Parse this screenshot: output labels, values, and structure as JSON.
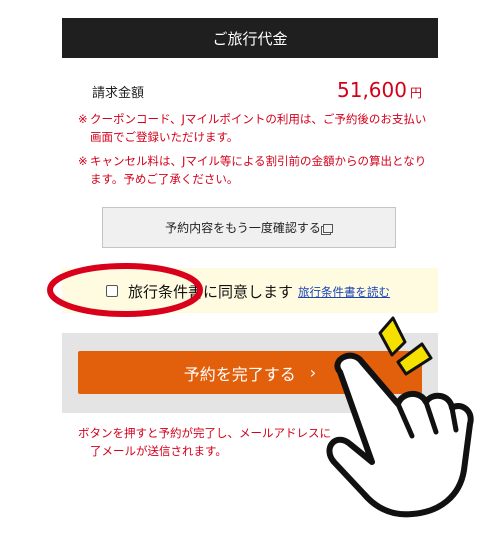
{
  "header": {
    "title": "ご旅行代金"
  },
  "amount": {
    "label": "請求金額",
    "value": "51,600",
    "unit": "円"
  },
  "notes": [
    {
      "mark": "※",
      "text": "クーポンコード、Jマイルポイントの利用は、ご予約後のお支払い画面でご登録いただけます。"
    },
    {
      "mark": "※",
      "text": "キャンセル料は、Jマイル等による割引前の金額からの算出となります。予めご了承ください。"
    }
  ],
  "confirm_button": {
    "label": "予約内容をもう一度確認する",
    "icon": "external-window-icon"
  },
  "agreement": {
    "checkbox_checked": false,
    "text": "旅行条件書に同意します",
    "link": "旅行条件書を読む"
  },
  "submit_button": {
    "label": "予約を完了する",
    "icon": "chevron-right-icon"
  },
  "bottom_note": {
    "line1": "ボタンを押すと予約が完了し、メールアドレスに",
    "line2": "了メールが送信されます。"
  },
  "colors": {
    "accent_orange": "#e2600b",
    "notice_red": "#d4001a",
    "highlight_circle": "#d9001b",
    "link_blue": "#1a43b8"
  },
  "annotations": {
    "highlight": "red-ellipse-around-checkbox",
    "pointer": "pointing-hand-illustration"
  }
}
